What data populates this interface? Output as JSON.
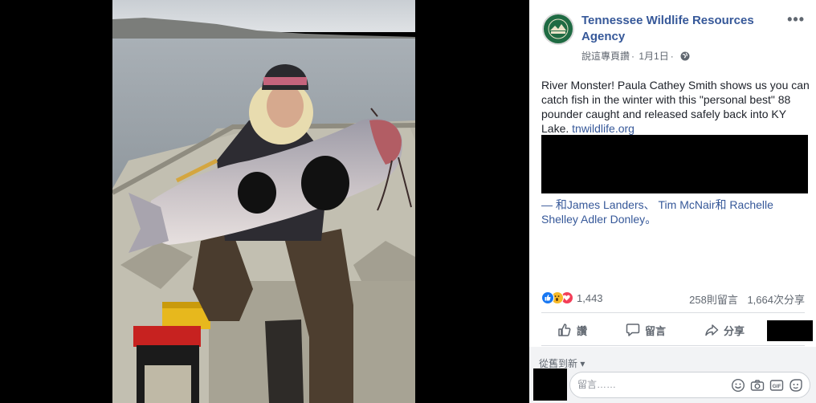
{
  "post": {
    "page_name": "Tennessee Wildlife Resources Agency",
    "meta": {
      "source": "說這專頁讚",
      "date": "1月1日"
    },
    "caption": "River Monster! Paula Cathey Smith shows us you can catch fish in the winter with this \"personal best\" 88 pounder caught and released safely back into KY Lake.",
    "link_text": "tnwildlife.org",
    "tagged": {
      "prefix": "— 和",
      "name1": "James Landers",
      "sep1": "、 ",
      "name2": "Tim McNair",
      "sep2": "和 ",
      "name3": "Rachelle Shelley Adler Donley",
      "suffix": "。"
    }
  },
  "stats": {
    "reactions": "1,443",
    "comments": "258則留言",
    "shares": "1,664次分享"
  },
  "actions": {
    "like": "讚",
    "comment": "留言",
    "share": "分享"
  },
  "comments_section": {
    "sort_label": "從舊到新 ▾",
    "placeholder": "留言……"
  },
  "icons": {
    "header": [
      "agency-logo-icon",
      "more-options-icon",
      "globe-icon"
    ],
    "reactions": [
      "like-reaction-icon",
      "wow-reaction-icon",
      "love-reaction-icon"
    ],
    "actions": [
      "thumbs-up-icon",
      "comment-bubble-icon",
      "share-arrow-icon"
    ],
    "composer": [
      "emoji-icon",
      "camera-icon",
      "gif-icon",
      "sticker-icon"
    ]
  },
  "colors": {
    "link": "#365899",
    "agency_green": "#1f6b43",
    "like_blue": "#1877f2",
    "wow_yellow": "#f7b928",
    "love_red": "#f33e58"
  }
}
